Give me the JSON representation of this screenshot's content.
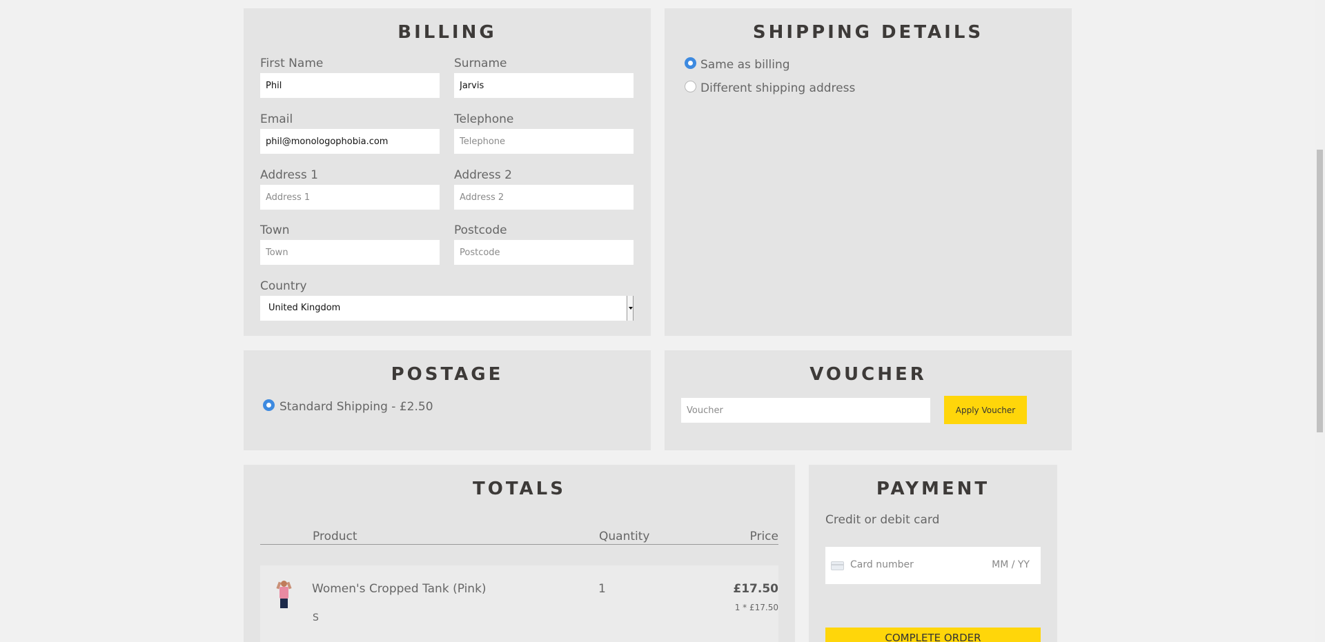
{
  "billing": {
    "title": "BILLING",
    "first_name": {
      "label": "First Name",
      "value": "Phil",
      "placeholder": "First Name"
    },
    "surname": {
      "label": "Surname",
      "value": "Jarvis",
      "placeholder": "Surname"
    },
    "email": {
      "label": "Email",
      "value": "phil@monologophobia.com",
      "placeholder": "Email"
    },
    "telephone": {
      "label": "Telephone",
      "value": "",
      "placeholder": "Telephone"
    },
    "address1": {
      "label": "Address 1",
      "value": "",
      "placeholder": "Address 1"
    },
    "address2": {
      "label": "Address 2",
      "value": "",
      "placeholder": "Address 2"
    },
    "town": {
      "label": "Town",
      "value": "",
      "placeholder": "Town"
    },
    "postcode": {
      "label": "Postcode",
      "value": "",
      "placeholder": "Postcode"
    },
    "country": {
      "label": "Country",
      "value": "United Kingdom"
    }
  },
  "shipping": {
    "title": "SHIPPING DETAILS",
    "options": [
      {
        "label": "Same as billing",
        "selected": true
      },
      {
        "label": "Different shipping address",
        "selected": false
      }
    ]
  },
  "postage": {
    "title": "POSTAGE",
    "options": [
      {
        "label": "Standard Shipping - £2.50",
        "selected": true
      }
    ]
  },
  "voucher": {
    "title": "VOUCHER",
    "placeholder": "Voucher",
    "button_label": "Apply Voucher"
  },
  "totals": {
    "title": "TOTALS",
    "columns": {
      "product": "Product",
      "quantity": "Quantity",
      "price": "Price"
    },
    "items": [
      {
        "name": "Women's Cropped Tank (Pink)",
        "variant": "S",
        "quantity": "1",
        "price": "£17.50",
        "unit_calc": "1 * £17.50"
      }
    ]
  },
  "payment": {
    "title": "PAYMENT",
    "subtitle": "Credit or debit card",
    "card_placeholder": "Card number",
    "expiry_placeholder": "MM / YY",
    "complete_label": "COMPLETE ORDER"
  },
  "colors": {
    "accent": "#ffd60a",
    "radio": "#3d8ae0",
    "panel": "#e4e4e4",
    "background": "#f1f1f1"
  }
}
